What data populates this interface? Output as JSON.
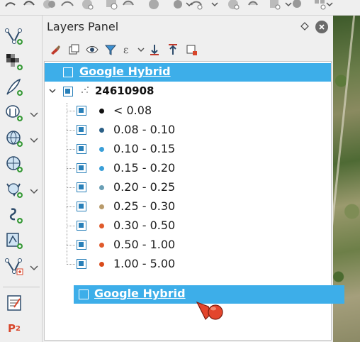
{
  "toolbar_top": {
    "icons": [
      "select-features-icon",
      "deselect-icon",
      "identify-icon",
      "measure-icon",
      "pan-map-icon",
      "zoom-in-icon",
      "zoom-out-icon",
      "zoom-full-icon",
      "grid-icon"
    ]
  },
  "toolbar_left": {
    "icons": [
      "new-vector-layer-icon",
      "add-raster-layer-icon",
      "add-delimited-text-icon",
      "add-postgis-layer-icon",
      "add-wms-layer-icon",
      "add-wfs-layer-icon",
      "add-virtual-layer-icon",
      "add-spatialite-icon",
      "add-mssql-icon",
      "new-temporary-layer-icon",
      "report-icon",
      "plugin-p2-icon"
    ],
    "p2_label": "P",
    "p2_sup": "2"
  },
  "panel": {
    "title": "Layers Panel"
  },
  "layers": {
    "top_layer": {
      "name": "Google Hybrid",
      "checked": false,
      "selected": true
    },
    "point_layer": {
      "name": "24610908",
      "checked": true,
      "expanded": true,
      "classes": [
        {
          "label": "< 0.08",
          "color": "#111111"
        },
        {
          "label": "0.08 - 0.10",
          "color": "#2b5f86"
        },
        {
          "label": "0.10 - 0.15",
          "color": "#3a9fd8"
        },
        {
          "label": "0.15 - 0.20",
          "color": "#3a9fd8"
        },
        {
          "label": "0.20 - 0.25",
          "color": "#6a9fb5"
        },
        {
          "label": "0.25 - 0.30",
          "color": "#b89a6a"
        },
        {
          "label": "0.30 - 0.50",
          "color": "#e05a2b"
        },
        {
          "label": "0.50 - 1.00",
          "color": "#e05a2b"
        },
        {
          "label": "1.00 - 5.00",
          "color": "#d94a1a"
        }
      ]
    }
  },
  "drag_ghost": {
    "name": "Google Hybrid"
  },
  "colors": {
    "selection": "#3daee9",
    "checkbox": "#2980b9"
  }
}
